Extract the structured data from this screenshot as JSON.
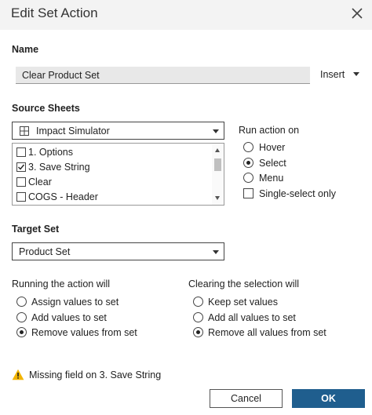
{
  "dialog": {
    "title": "Edit Set Action"
  },
  "name_section": {
    "label": "Name",
    "value": "Clear Product Set",
    "insert_label": "Insert"
  },
  "source": {
    "label": "Source Sheets",
    "selected_source": "Impact Simulator",
    "sheets": [
      {
        "label": "1. Options",
        "checked": false
      },
      {
        "label": "3. Save String",
        "checked": true
      },
      {
        "label": "Clear",
        "checked": false
      },
      {
        "label": "COGS - Header",
        "checked": false
      }
    ]
  },
  "run_action": {
    "label": "Run action on",
    "options": [
      "Hover",
      "Select",
      "Menu"
    ],
    "selected": "Select",
    "single_select_label": "Single-select only",
    "single_select_checked": false
  },
  "target": {
    "label": "Target Set",
    "value": "Product Set"
  },
  "running": {
    "label": "Running the action will",
    "options": [
      "Assign values to set",
      "Add values to set",
      "Remove values from set"
    ],
    "selected": "Remove values from set"
  },
  "clearing": {
    "label": "Clearing the selection will",
    "options": [
      "Keep set values",
      "Add all values to set",
      "Remove all values from set"
    ],
    "selected": "Remove all values from set"
  },
  "warning": {
    "text": "Missing field on 3. Save String"
  },
  "buttons": {
    "cancel": "Cancel",
    "ok": "OK"
  },
  "colors": {
    "ok_button": "#1f5e8e",
    "warning_icon": "#f2b400"
  }
}
